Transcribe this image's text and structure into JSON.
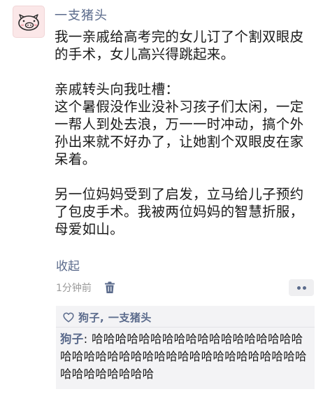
{
  "post": {
    "author": "一支猪头",
    "paragraphs": [
      "我一亲戚给高考完的女儿订了个割双眼皮的手术，女儿高兴得跳起来。",
      "亲戚转头向我吐槽：\n这个暑假没作业没补习孩子们太闲，一定一帮人到处去浪，万一一时冲动，搞个外孙出来就不好办了，让她割个双眼皮在家呆着。",
      "另一位妈妈受到了启发，立马给儿子预约了包皮手术。我被两位妈妈的智慧折服，母爱如山。"
    ],
    "collapse_label": "收起",
    "time": "1分钟前"
  },
  "likes": {
    "names": "狗子, 一支猪头"
  },
  "comment": {
    "author": "狗子",
    "separator": ": ",
    "text": "哈哈哈哈哈哈哈哈哈哈哈哈哈哈哈哈哈哈哈哈哈哈哈哈哈哈哈哈哈哈哈哈哈哈哈哈哈哈哈哈哈哈哈哈哈哈哈"
  },
  "icons": {
    "avatar": "pig-face-icon",
    "delete": "trash-icon",
    "more": "more-dots-icon",
    "like": "heart-icon"
  },
  "colors": {
    "link": "#5b6b8c",
    "avatar_bg": "#fbe7e8",
    "interaction_bg": "#f3f3f5"
  }
}
